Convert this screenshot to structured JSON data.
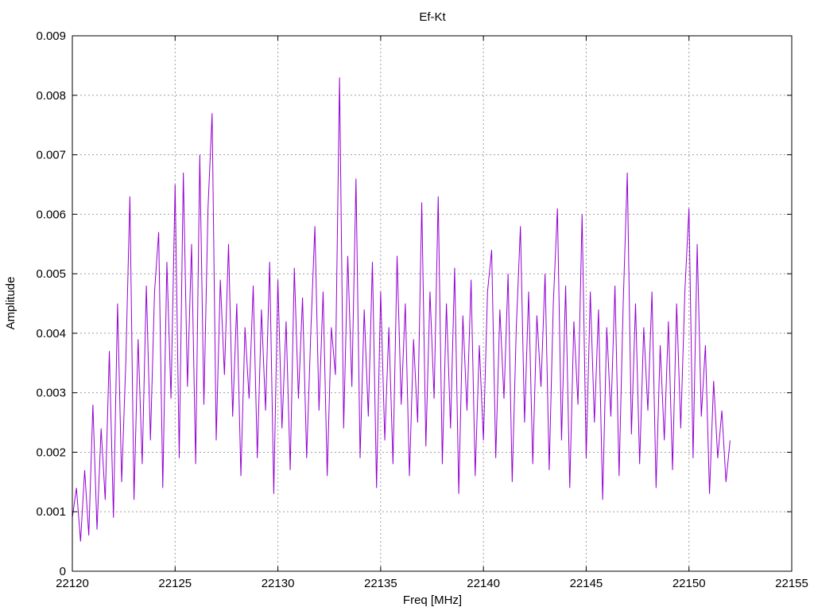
{
  "chart_data": {
    "type": "line",
    "title": "Ef-Kt",
    "xlabel": "Freq [MHz]",
    "ylabel": "Amplitude",
    "xlim": [
      22120,
      22155
    ],
    "ylim": [
      0,
      0.009
    ],
    "x_ticks": [
      22120,
      22125,
      22130,
      22135,
      22140,
      22145,
      22150,
      22155
    ],
    "x_tick_labels": [
      "22120",
      "22125",
      "22130",
      "22135",
      "22140",
      "22145",
      "22150",
      "22155"
    ],
    "y_ticks": [
      0,
      0.001,
      0.002,
      0.003,
      0.004,
      0.005,
      0.006,
      0.007,
      0.008,
      0.009
    ],
    "y_tick_labels": [
      "0",
      "0.001",
      "0.002",
      "0.003",
      "0.004",
      "0.005",
      "0.006",
      "0.007",
      "0.008",
      "0.009"
    ],
    "grid": true,
    "legend": "none",
    "series": [
      {
        "color": "#9400d3",
        "x_start": 22120,
        "x_end": 22152,
        "points": [
          [
            22120.0,
            0.0009
          ],
          [
            22120.2,
            0.0014
          ],
          [
            22120.4,
            0.0005
          ],
          [
            22120.6,
            0.0017
          ],
          [
            22120.8,
            0.0006
          ],
          [
            22121.0,
            0.0028
          ],
          [
            22121.2,
            0.0007
          ],
          [
            22121.4,
            0.0024
          ],
          [
            22121.6,
            0.0012
          ],
          [
            22121.8,
            0.0037
          ],
          [
            22122.0,
            0.0009
          ],
          [
            22122.2,
            0.0045
          ],
          [
            22122.4,
            0.0015
          ],
          [
            22122.6,
            0.0035
          ],
          [
            22122.8,
            0.0063
          ],
          [
            22123.0,
            0.0012
          ],
          [
            22123.2,
            0.0039
          ],
          [
            22123.4,
            0.0018
          ],
          [
            22123.6,
            0.0048
          ],
          [
            22123.8,
            0.0022
          ],
          [
            22124.0,
            0.0047
          ],
          [
            22124.2,
            0.0057
          ],
          [
            22124.4,
            0.0014
          ],
          [
            22124.6,
            0.0052
          ],
          [
            22124.8,
            0.0029
          ],
          [
            22125.0,
            0.0065
          ],
          [
            22125.2,
            0.0019
          ],
          [
            22125.4,
            0.0067
          ],
          [
            22125.6,
            0.0031
          ],
          [
            22125.8,
            0.0055
          ],
          [
            22126.0,
            0.0018
          ],
          [
            22126.2,
            0.007
          ],
          [
            22126.4,
            0.0028
          ],
          [
            22126.6,
            0.0061
          ],
          [
            22126.8,
            0.0077
          ],
          [
            22127.0,
            0.0022
          ],
          [
            22127.2,
            0.0049
          ],
          [
            22127.4,
            0.0033
          ],
          [
            22127.6,
            0.0055
          ],
          [
            22127.8,
            0.0026
          ],
          [
            22128.0,
            0.0045
          ],
          [
            22128.2,
            0.0016
          ],
          [
            22128.4,
            0.0041
          ],
          [
            22128.6,
            0.0029
          ],
          [
            22128.8,
            0.0048
          ],
          [
            22129.0,
            0.0019
          ],
          [
            22129.2,
            0.0044
          ],
          [
            22129.4,
            0.0027
          ],
          [
            22129.6,
            0.0052
          ],
          [
            22129.8,
            0.0013
          ],
          [
            22130.0,
            0.0049
          ],
          [
            22130.2,
            0.0024
          ],
          [
            22130.4,
            0.0042
          ],
          [
            22130.6,
            0.0017
          ],
          [
            22130.8,
            0.0051
          ],
          [
            22131.0,
            0.0029
          ],
          [
            22131.2,
            0.0046
          ],
          [
            22131.4,
            0.0019
          ],
          [
            22131.6,
            0.004
          ],
          [
            22131.8,
            0.0058
          ],
          [
            22132.0,
            0.0027
          ],
          [
            22132.2,
            0.0047
          ],
          [
            22132.4,
            0.0016
          ],
          [
            22132.6,
            0.0041
          ],
          [
            22132.8,
            0.0033
          ],
          [
            22133.0,
            0.0083
          ],
          [
            22133.2,
            0.0024
          ],
          [
            22133.4,
            0.0053
          ],
          [
            22133.6,
            0.0031
          ],
          [
            22133.8,
            0.0066
          ],
          [
            22134.0,
            0.0019
          ],
          [
            22134.2,
            0.0044
          ],
          [
            22134.4,
            0.0026
          ],
          [
            22134.6,
            0.0052
          ],
          [
            22134.8,
            0.0014
          ],
          [
            22135.0,
            0.0047
          ],
          [
            22135.2,
            0.0022
          ],
          [
            22135.4,
            0.0041
          ],
          [
            22135.6,
            0.0018
          ],
          [
            22135.8,
            0.0053
          ],
          [
            22136.0,
            0.0028
          ],
          [
            22136.2,
            0.0045
          ],
          [
            22136.4,
            0.0016
          ],
          [
            22136.6,
            0.0039
          ],
          [
            22136.8,
            0.0025
          ],
          [
            22137.0,
            0.0062
          ],
          [
            22137.2,
            0.0021
          ],
          [
            22137.4,
            0.0047
          ],
          [
            22137.6,
            0.0029
          ],
          [
            22137.8,
            0.0063
          ],
          [
            22138.0,
            0.0018
          ],
          [
            22138.2,
            0.0045
          ],
          [
            22138.4,
            0.0024
          ],
          [
            22138.6,
            0.0051
          ],
          [
            22138.8,
            0.0013
          ],
          [
            22139.0,
            0.0043
          ],
          [
            22139.2,
            0.0027
          ],
          [
            22139.4,
            0.0049
          ],
          [
            22139.6,
            0.0016
          ],
          [
            22139.8,
            0.0038
          ],
          [
            22140.0,
            0.0022
          ],
          [
            22140.2,
            0.0047
          ],
          [
            22140.4,
            0.0054
          ],
          [
            22140.6,
            0.0019
          ],
          [
            22140.8,
            0.0044
          ],
          [
            22141.0,
            0.0029
          ],
          [
            22141.2,
            0.005
          ],
          [
            22141.4,
            0.0015
          ],
          [
            22141.6,
            0.0041
          ],
          [
            22141.8,
            0.0058
          ],
          [
            22142.0,
            0.0025
          ],
          [
            22142.2,
            0.0047
          ],
          [
            22142.4,
            0.0018
          ],
          [
            22142.6,
            0.0043
          ],
          [
            22142.8,
            0.0031
          ],
          [
            22143.0,
            0.005
          ],
          [
            22143.2,
            0.0017
          ],
          [
            22143.4,
            0.0045
          ],
          [
            22143.6,
            0.0061
          ],
          [
            22143.8,
            0.0022
          ],
          [
            22144.0,
            0.0048
          ],
          [
            22144.2,
            0.0014
          ],
          [
            22144.4,
            0.0042
          ],
          [
            22144.6,
            0.0028
          ],
          [
            22144.8,
            0.006
          ],
          [
            22145.0,
            0.0019
          ],
          [
            22145.2,
            0.0047
          ],
          [
            22145.4,
            0.0025
          ],
          [
            22145.6,
            0.0044
          ],
          [
            22145.8,
            0.0012
          ],
          [
            22146.0,
            0.0041
          ],
          [
            22146.2,
            0.0026
          ],
          [
            22146.4,
            0.0048
          ],
          [
            22146.6,
            0.0016
          ],
          [
            22146.8,
            0.0045
          ],
          [
            22147.0,
            0.0067
          ],
          [
            22147.2,
            0.0023
          ],
          [
            22147.4,
            0.0045
          ],
          [
            22147.6,
            0.0018
          ],
          [
            22147.8,
            0.0041
          ],
          [
            22148.0,
            0.0027
          ],
          [
            22148.2,
            0.0047
          ],
          [
            22148.4,
            0.0014
          ],
          [
            22148.6,
            0.0038
          ],
          [
            22148.8,
            0.0022
          ],
          [
            22149.0,
            0.0042
          ],
          [
            22149.2,
            0.0017
          ],
          [
            22149.4,
            0.0045
          ],
          [
            22149.6,
            0.0024
          ],
          [
            22149.8,
            0.0047
          ],
          [
            22150.0,
            0.0061
          ],
          [
            22150.2,
            0.0019
          ],
          [
            22150.4,
            0.0055
          ],
          [
            22150.6,
            0.0026
          ],
          [
            22150.8,
            0.0038
          ],
          [
            22151.0,
            0.0013
          ],
          [
            22151.2,
            0.0032
          ],
          [
            22151.4,
            0.0019
          ],
          [
            22151.6,
            0.0027
          ],
          [
            22151.8,
            0.0015
          ],
          [
            22152.0,
            0.0022
          ]
        ]
      }
    ]
  }
}
